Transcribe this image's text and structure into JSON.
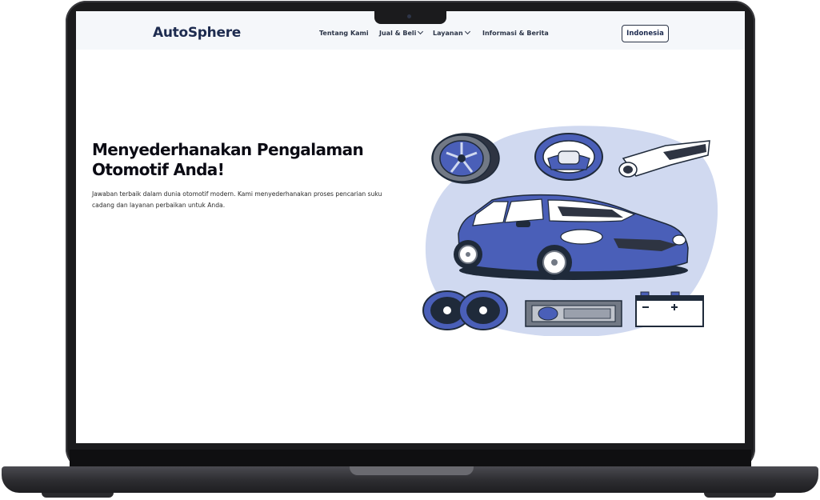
{
  "navbar": {
    "brand": "AutoSphere",
    "items": [
      {
        "label": "Tentang Kami"
      },
      {
        "label": "Jual & Beli"
      },
      {
        "label": "Layanan"
      },
      {
        "label": "Informasi & Berita"
      }
    ],
    "language_button": "Indonesia"
  },
  "hero": {
    "title": "Menyederhanakan Pengalaman Otomotif Anda!",
    "description": "Jawaban terbaik dalam dunia otomotif modern. Kami menyederhanakan proses pencarian suku cadang dan layanan perbaikan untuk Anda."
  },
  "illustration": {
    "icons": [
      "tire-icon",
      "steering-wheel-icon",
      "exhaust-pipe-icon",
      "car-icon",
      "speakers-icon",
      "car-stereo-icon",
      "car-battery-icon"
    ],
    "colors": {
      "blob": "#d0d9f0",
      "primary": "#4a5fb8",
      "outline": "#1f2a3a"
    }
  }
}
